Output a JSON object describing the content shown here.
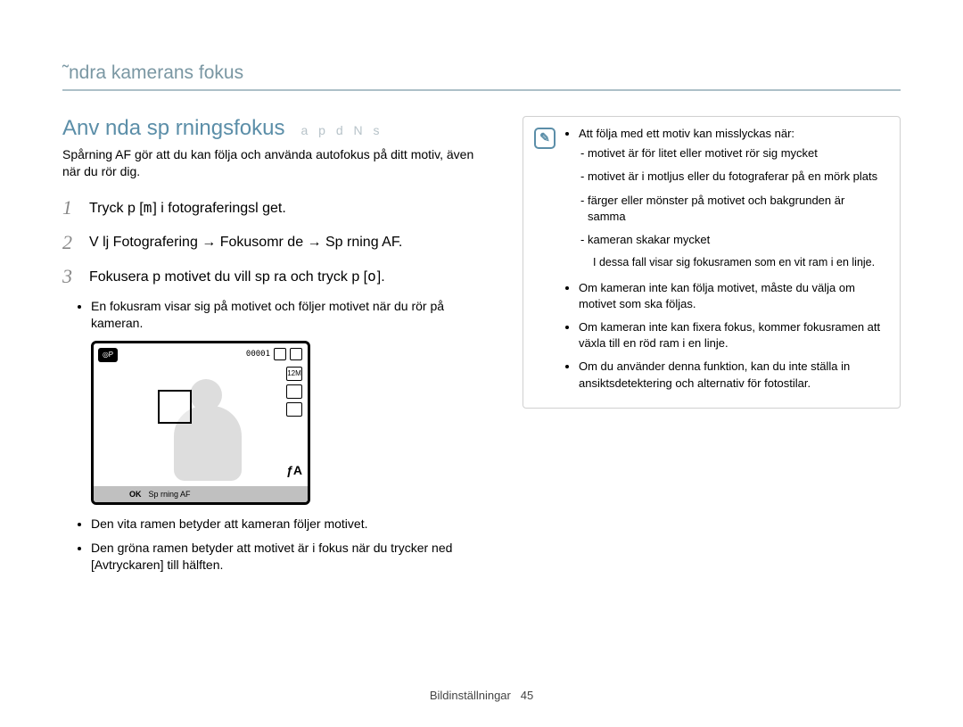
{
  "page": {
    "section_title": "˜ndra kamerans fokus",
    "footer_label": "Bildinställningar",
    "footer_page": "45"
  },
  "left": {
    "heading": "Anv nda sp rningsfokus",
    "heading_modes": "a p d N s",
    "intro": "Spårning AF gör att du kan följa och använda autofokus på ditt motiv, även när du rör dig.",
    "steps": {
      "1": {
        "num": "1",
        "pre": "Tryck p  [",
        "icon": "m",
        "post": "] i fotograferingsl get."
      },
      "2": {
        "num": "2",
        "text_a": "V lj Fotografering ",
        "arrow1": "→",
        "text_b": " Fokusomr de ",
        "arrow2": "→",
        "text_c": " Sp rning AF."
      },
      "3": {
        "num": "3",
        "pre": "Fokusera p  motivet du vill sp ra och tryck p  [",
        "icon": "o",
        "post": "]."
      }
    },
    "sub_a": "En fokusram visar sig på motivet och följer motivet när du rör på kameran.",
    "sub_b": "Den vita ramen betyder att kameran följer motivet.",
    "sub_c_pre": "Den gröna ramen betyder att motivet är i fokus när du trycker ned [",
    "sub_c_key": "Avtryckaren",
    "sub_c_post": "] till hälften.",
    "lcd": {
      "mode_icon": "◎P",
      "counter": "00001",
      "res_label": "12M",
      "flash": "ƒA",
      "ok_label": "OK",
      "footer_text": "Sp rning AF"
    }
  },
  "right": {
    "bullet1_head": "Att följa med ett motiv kan misslyckas när:",
    "bullet1_items": [
      "motivet är för litet eller motivet rör sig mycket",
      "motivet är i motljus eller du fotograferar på en mörk plats",
      "färger eller mönster på motivet och bakgrunden är samma",
      "kameran skakar mycket"
    ],
    "bullet1_tail": "I dessa fall visar sig fokusramen som en vit ram i en linje.",
    "bullet2": "Om kameran inte kan följa motivet, måste du välja om motivet som ska följas.",
    "bullet3": "Om kameran inte kan fixera fokus, kommer fokusramen att växla till en röd ram i en linje.",
    "bullet4": "Om du använder denna funktion, kan du inte ställa in ansiktsdetektering och alternativ för fotostilar."
  }
}
